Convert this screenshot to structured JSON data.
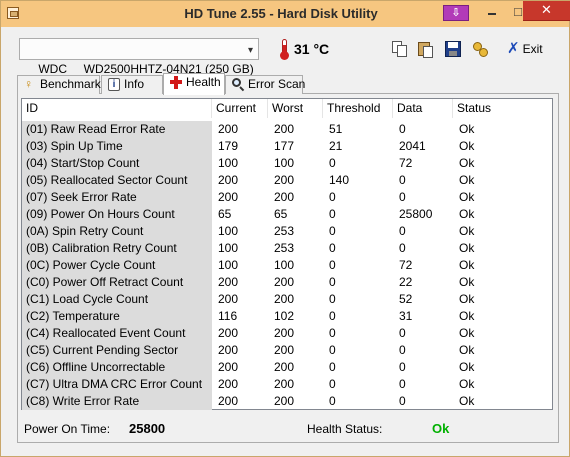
{
  "window": {
    "title": "HD Tune 2.55 - Hard Disk Utility",
    "download_glyph": "⇩",
    "minimize_glyph": "",
    "maximize_glyph": "□",
    "close_glyph": "✕"
  },
  "toolbar": {
    "drive_label": "WDC     WD2500HHTZ-04N21 (250 GB)",
    "drive_arrow": "▾",
    "temperature": "31 °C",
    "exit_glyph": "✗",
    "exit_label": "Exit"
  },
  "tabs": [
    {
      "label": "Benchmark",
      "icon": "benchmark-icon",
      "active": false
    },
    {
      "label": "Info",
      "icon": "info-icon",
      "active": false
    },
    {
      "label": "Health",
      "icon": "health-icon",
      "active": true
    },
    {
      "label": "Error Scan",
      "icon": "error-scan-icon",
      "active": false
    }
  ],
  "table": {
    "columns": [
      "ID",
      "Current",
      "Worst",
      "Threshold",
      "Data",
      "Status"
    ],
    "rows": [
      {
        "id": "(01) Raw Read Error Rate",
        "current": "200",
        "worst": "200",
        "threshold": "51",
        "data": "0",
        "status": "Ok"
      },
      {
        "id": "(03) Spin Up Time",
        "current": "179",
        "worst": "177",
        "threshold": "21",
        "data": "2041",
        "status": "Ok"
      },
      {
        "id": "(04) Start/Stop Count",
        "current": "100",
        "worst": "100",
        "threshold": "0",
        "data": "72",
        "status": "Ok"
      },
      {
        "id": "(05) Reallocated Sector Count",
        "current": "200",
        "worst": "200",
        "threshold": "140",
        "data": "0",
        "status": "Ok"
      },
      {
        "id": "(07) Seek Error Rate",
        "current": "200",
        "worst": "200",
        "threshold": "0",
        "data": "0",
        "status": "Ok"
      },
      {
        "id": "(09) Power On Hours Count",
        "current": "65",
        "worst": "65",
        "threshold": "0",
        "data": "25800",
        "status": "Ok"
      },
      {
        "id": "(0A) Spin Retry Count",
        "current": "100",
        "worst": "253",
        "threshold": "0",
        "data": "0",
        "status": "Ok"
      },
      {
        "id": "(0B) Calibration Retry Count",
        "current": "100",
        "worst": "253",
        "threshold": "0",
        "data": "0",
        "status": "Ok"
      },
      {
        "id": "(0C) Power Cycle Count",
        "current": "100",
        "worst": "100",
        "threshold": "0",
        "data": "72",
        "status": "Ok"
      },
      {
        "id": "(C0) Power Off Retract Count",
        "current": "200",
        "worst": "200",
        "threshold": "0",
        "data": "22",
        "status": "Ok"
      },
      {
        "id": "(C1) Load Cycle Count",
        "current": "200",
        "worst": "200",
        "threshold": "0",
        "data": "52",
        "status": "Ok"
      },
      {
        "id": "(C2) Temperature",
        "current": "116",
        "worst": "102",
        "threshold": "0",
        "data": "31",
        "status": "Ok"
      },
      {
        "id": "(C4) Reallocated Event Count",
        "current": "200",
        "worst": "200",
        "threshold": "0",
        "data": "0",
        "status": "Ok"
      },
      {
        "id": "(C5) Current Pending Sector",
        "current": "200",
        "worst": "200",
        "threshold": "0",
        "data": "0",
        "status": "Ok"
      },
      {
        "id": "(C6) Offline Uncorrectable",
        "current": "200",
        "worst": "200",
        "threshold": "0",
        "data": "0",
        "status": "Ok"
      },
      {
        "id": "(C7) Ultra DMA CRC Error Count",
        "current": "200",
        "worst": "200",
        "threshold": "0",
        "data": "0",
        "status": "Ok"
      },
      {
        "id": "(C8) Write Error Rate",
        "current": "200",
        "worst": "200",
        "threshold": "0",
        "data": "0",
        "status": "Ok"
      }
    ]
  },
  "footer": {
    "power_on_time_label": "Power On Time:",
    "power_on_time_value": "25800",
    "health_status_label": "Health Status:",
    "health_status_value": "Ok"
  },
  "colors": {
    "titlebar": "#f6c680",
    "close_button": "#c7372b",
    "download_button": "#b23ab8",
    "health_ok": "#00b000",
    "id_column_bg": "#dcdcdc"
  }
}
